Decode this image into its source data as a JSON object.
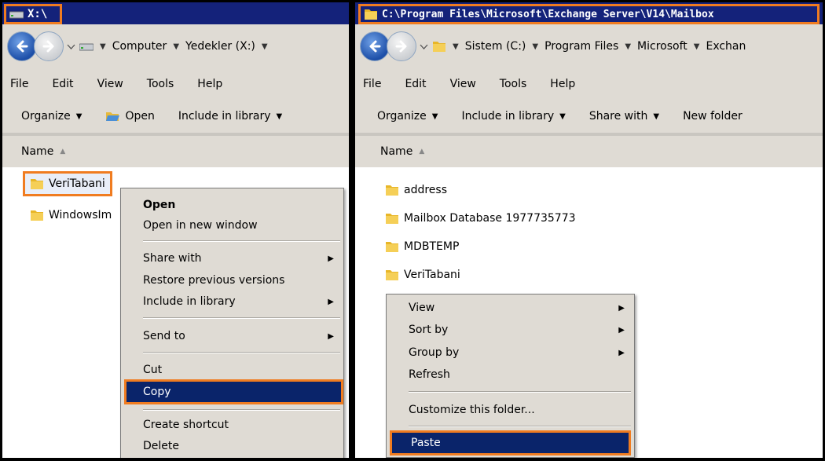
{
  "left": {
    "title": "X:\\",
    "breadcrumb": [
      "Computer",
      "Yedekler (X:)"
    ],
    "menu": [
      "File",
      "Edit",
      "View",
      "Tools",
      "Help"
    ],
    "toolbar": {
      "organize": "Organize",
      "open": "Open",
      "include": "Include in library"
    },
    "column_header": "Name",
    "files": [
      "VeriTabani",
      "WindowsIm"
    ],
    "context_menu": {
      "open": "Open",
      "open_new_window": "Open in new window",
      "share_with": "Share with",
      "restore": "Restore previous versions",
      "include": "Include in library",
      "send_to": "Send to",
      "cut": "Cut",
      "copy": "Copy",
      "create_shortcut": "Create shortcut",
      "delete": "Delete"
    }
  },
  "right": {
    "title": "C:\\Program Files\\Microsoft\\Exchange Server\\V14\\Mailbox",
    "breadcrumb": [
      "Sistem (C:)",
      "Program Files",
      "Microsoft",
      "Exchan"
    ],
    "menu": [
      "File",
      "Edit",
      "View",
      "Tools",
      "Help"
    ],
    "toolbar": {
      "organize": "Organize",
      "include": "Include in library",
      "share": "Share with",
      "new_folder": "New folder"
    },
    "column_header": "Name",
    "files": [
      "address",
      "Mailbox Database 1977735773",
      "MDBTEMP",
      "VeriTabani"
    ],
    "context_menu": {
      "view": "View",
      "sort_by": "Sort by",
      "group_by": "Group by",
      "refresh": "Refresh",
      "customize": "Customize this folder...",
      "paste": "Paste"
    }
  },
  "colors": {
    "highlight": "#0a246a",
    "annotation": "#f07c20",
    "chrome": "#dfdbd4",
    "titlebar": "#14227a"
  }
}
